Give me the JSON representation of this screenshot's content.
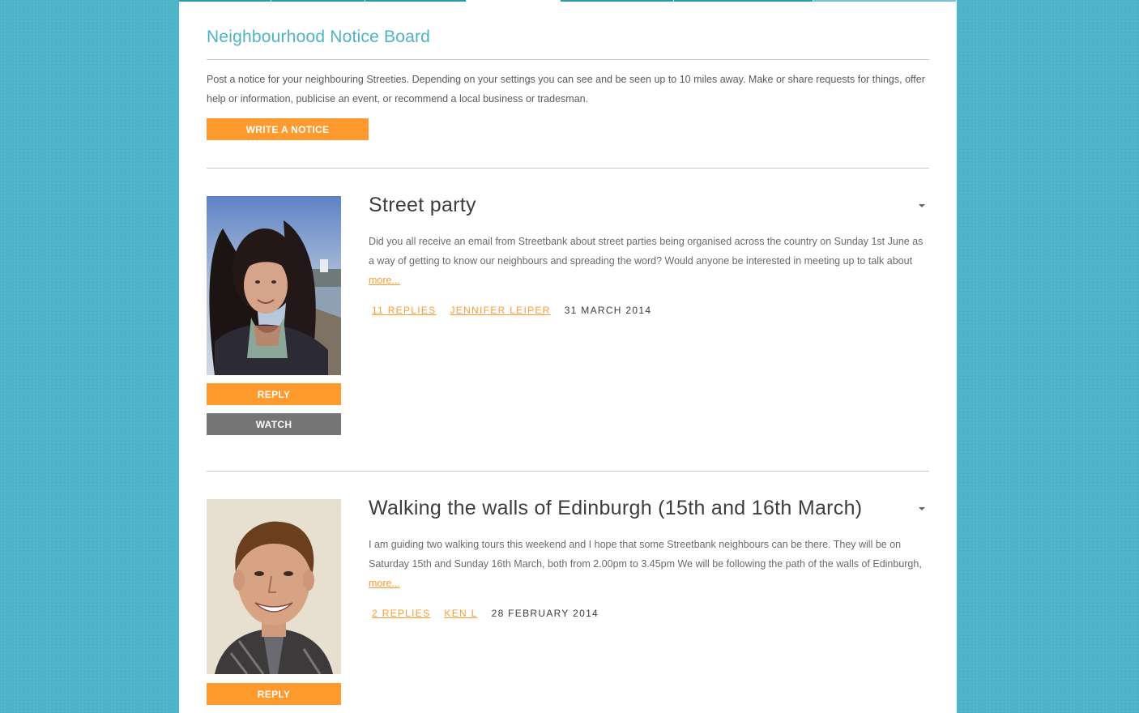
{
  "nav": {
    "segments": [
      "",
      "",
      "",
      "",
      "",
      "",
      ""
    ]
  },
  "board": {
    "title": "Neighbourhood Notice Board",
    "intro": "Post a notice for your neighbouring Streeties. Depending on your settings you can see and be seen up to 10 miles away. Make or share requests for things, offer help or information, publicise an event, or recommend a local business or tradesman.",
    "write_button": "WRITE A NOTICE"
  },
  "colors": {
    "background": "#4db5c9",
    "accent": "#ff9a2e",
    "title": "#4fb3c6",
    "watch_button": "#757575"
  },
  "notices": [
    {
      "title": "Street party",
      "body": "Did you all receive an email from Streetbank about street parties being organised across the country on Sunday 1st June as a way of getting to know our neighbours and spreading the word? Would anyone be interested in meeting up to talk about",
      "more": "more...",
      "replies": "11 REPLIES",
      "author": "JENNIFER LEIPER",
      "date": "31 MARCH 2014",
      "reply_button": "REPLY",
      "watch_button": "WATCH",
      "avatar_icon": "user-photo-icon"
    },
    {
      "title": "Walking the walls of Edinburgh (15th and 16th March)",
      "body": "I am guiding two walking tours this weekend and I hope that some Streetbank neighbours can be there. They will be on Saturday 15th and Sunday 16th March, both from 2.00pm to 3.45pm We will be following the path of the walls of Edinburgh,",
      "more": "more...",
      "replies": "2 REPLIES",
      "author": "KEN L",
      "date": "28 FEBRUARY 2014",
      "reply_button": "REPLY",
      "avatar_icon": "user-photo-icon"
    }
  ]
}
